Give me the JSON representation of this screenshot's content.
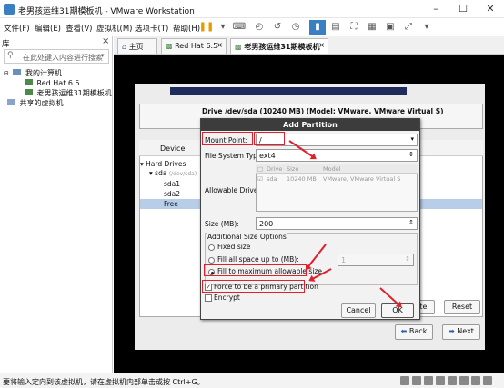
{
  "window": {
    "title": "老男孩运维31期模板机 - VMware Workstation"
  },
  "menu": [
    "文件(F)",
    "编辑(E)",
    "查看(V)",
    "虚拟机(M)",
    "选项卡(T)",
    "帮助(H)"
  ],
  "library": {
    "header": "库",
    "close": "×",
    "search_placeholder": "在此处键入内容进行搜索",
    "my_computer": "我的计算机",
    "vm1": "Red Hat 6.5",
    "vm2": "老男孩运维31期模板机",
    "shared": "共享的虚拟机"
  },
  "tabs": [
    {
      "label": "主页"
    },
    {
      "label": "Red Hat 6.5"
    },
    {
      "label": "老男孩运维31期模板机"
    }
  ],
  "installer": {
    "drive_line": "Drive /dev/sda (10240 MB) (Model: VMware, VMware Virtual S)",
    "device_header": "Device",
    "hard_drives": "Hard Drives",
    "sda": "sda",
    "sda_hint": "(/dev/sda)",
    "sda1": "sda1",
    "sda2": "sda2",
    "free": "Free",
    "delete_btn": "ete",
    "reset_btn": "Reset",
    "back_btn": "Back",
    "next_btn": "Next"
  },
  "dialog": {
    "title": "Add Partition",
    "mount_label": "Mount Point:",
    "mount_value": "/",
    "fs_label": "File System Type:",
    "fs_value": "ext4",
    "allowable_label": "Allowable Drives:",
    "drive_cols": [
      "Drive",
      "Size",
      "Model"
    ],
    "drive_row": {
      "drive": "sda",
      "size": "10240 MB",
      "model": "VMware, VMware Virtual S"
    },
    "size_label": "Size (MB):",
    "size_value": "200",
    "options_label": "Additional Size Options",
    "opt_fixed": "Fixed size",
    "opt_fill_upto": "Fill all space up to (MB):",
    "fill_upto_value": "1",
    "opt_fill_max": "Fill to maximum allowable size",
    "force_primary": "Force to be a primary partition",
    "encrypt": "Encrypt",
    "cancel": "Cancel",
    "ok": "OK"
  },
  "status": {
    "text": "要将输入定向到该虚拟机，请在虚拟机内部单击或按 Ctrl+G。"
  },
  "colors": {
    "annotation": "#e0202a",
    "selection": "#b8cde8",
    "title_bar": "#3c3c3c"
  }
}
